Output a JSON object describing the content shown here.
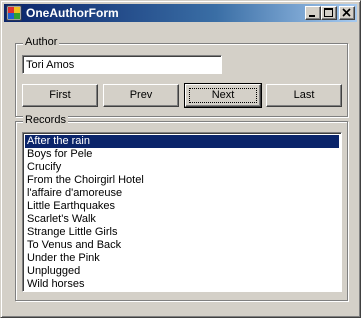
{
  "window": {
    "title": "OneAuthorForm"
  },
  "author": {
    "group_label": "Author",
    "value": "Tori Amos"
  },
  "nav": {
    "first": "First",
    "prev": "Prev",
    "next": "Next",
    "last": "Last"
  },
  "records": {
    "group_label": "Records",
    "items": [
      "After the rain",
      "Boys for Pele",
      "Crucify",
      "From the Choirgirl Hotel",
      "l'affaire d'amoreuse",
      "Little Earthquakes",
      "Scarlet's Walk",
      "Strange Little Girls",
      "To Venus and Back",
      "Under the Pink",
      "Unplugged",
      "Wild horses"
    ],
    "selected_index": 0
  },
  "colors": {
    "titlebar_start": "#0a246a",
    "titlebar_end": "#a6caf0",
    "selection": "#0a246a",
    "face": "#d4d0c8"
  }
}
